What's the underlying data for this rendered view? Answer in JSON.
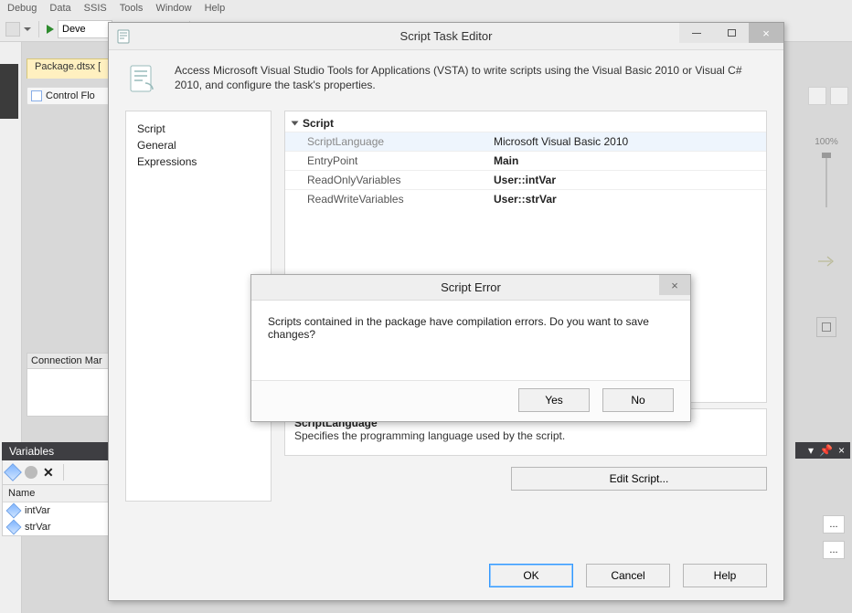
{
  "menu": {
    "items": [
      "Debug",
      "Data",
      "SSIS",
      "Tools",
      "Window",
      "Help"
    ]
  },
  "toolbar": {
    "config_value": "Deve"
  },
  "doc_tab": {
    "label": "Package.dtsx ["
  },
  "control_flow": {
    "label": "Control Flo"
  },
  "zoom": {
    "label": "100%"
  },
  "connections": {
    "title": "Connection Mar"
  },
  "variables": {
    "title": "Variables",
    "column": "Name",
    "rows": [
      {
        "name": "intVar"
      },
      {
        "name": "strVar"
      }
    ]
  },
  "dialog": {
    "title": "Script Task Editor",
    "description": "Access Microsoft Visual Studio Tools for Applications (VSTA) to write scripts using the Visual Basic 2010 or Visual C# 2010, and configure the task's properties.",
    "nav": {
      "items": [
        "Script",
        "General",
        "Expressions"
      ]
    },
    "section": "Script",
    "props": [
      {
        "name": "ScriptLanguage",
        "value": "Microsoft Visual Basic 2010",
        "muted": true
      },
      {
        "name": "EntryPoint",
        "value": "Main",
        "bold": true
      },
      {
        "name": "ReadOnlyVariables",
        "value": "User::intVar",
        "bold": true
      },
      {
        "name": "ReadWriteVariables",
        "value": "User::strVar",
        "bold": true
      }
    ],
    "help": {
      "title": "ScriptLanguage",
      "desc": "Specifies the programming language used by the script."
    },
    "edit_script": "Edit Script...",
    "buttons": {
      "ok": "OK",
      "cancel": "Cancel",
      "help": "Help"
    }
  },
  "error": {
    "title": "Script Error",
    "message": "Scripts contained in the package have compilation errors. Do you want to save changes?",
    "yes": "Yes",
    "no": "No"
  },
  "pin_row": {
    "pin": "▼",
    "square": "□",
    "x": "×"
  }
}
